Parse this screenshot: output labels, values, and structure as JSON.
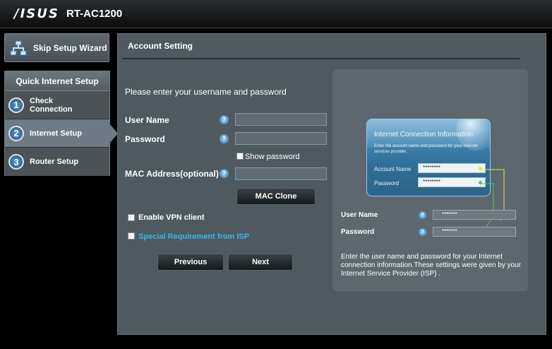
{
  "header": {
    "brand": "/ISUS",
    "model": "RT-AC1200"
  },
  "sidebar": {
    "skip_label": "Skip Setup Wizard",
    "heading": "Quick Internet Setup",
    "items": [
      {
        "num": "1",
        "label": "Check\nConnection",
        "active": false
      },
      {
        "num": "2",
        "label": "Internet Setup",
        "active": true
      },
      {
        "num": "3",
        "label": "Router Setup",
        "active": false
      }
    ]
  },
  "panel": {
    "title": "Account Setting",
    "intro": "Please enter your username and password",
    "username_label": "User Name",
    "username_value": "",
    "password_label": "Password",
    "password_value": "",
    "show_password_label": "Show password",
    "mac_label": "MAC Address(optional)",
    "mac_value": "",
    "mac_clone_label": "MAC Clone",
    "vpn_label": "Enable VPN client",
    "isp_label": "Special Requirement from ISP",
    "previous_label": "Previous",
    "next_label": "Next",
    "help_glyph": "?"
  },
  "illustration": {
    "card_title": "Internet Connection Information",
    "card_desc": "Enter the account name and password for your Internet services provider.",
    "card_account_label": "Account Name",
    "card_account_value": "********",
    "card_password_label": "Password",
    "card_password_value": "********",
    "username_label": "User Name",
    "username_mask": "*******",
    "password_label": "Password",
    "password_mask": "*******",
    "description": "Enter the user name and password for your Internet connection information.These settings were given by your Internet Service Provider (ISP) ."
  },
  "colors": {
    "connector_yellow": "#e8e23a",
    "connector_green": "#3fd14a",
    "link_blue": "#3bb6e8"
  }
}
